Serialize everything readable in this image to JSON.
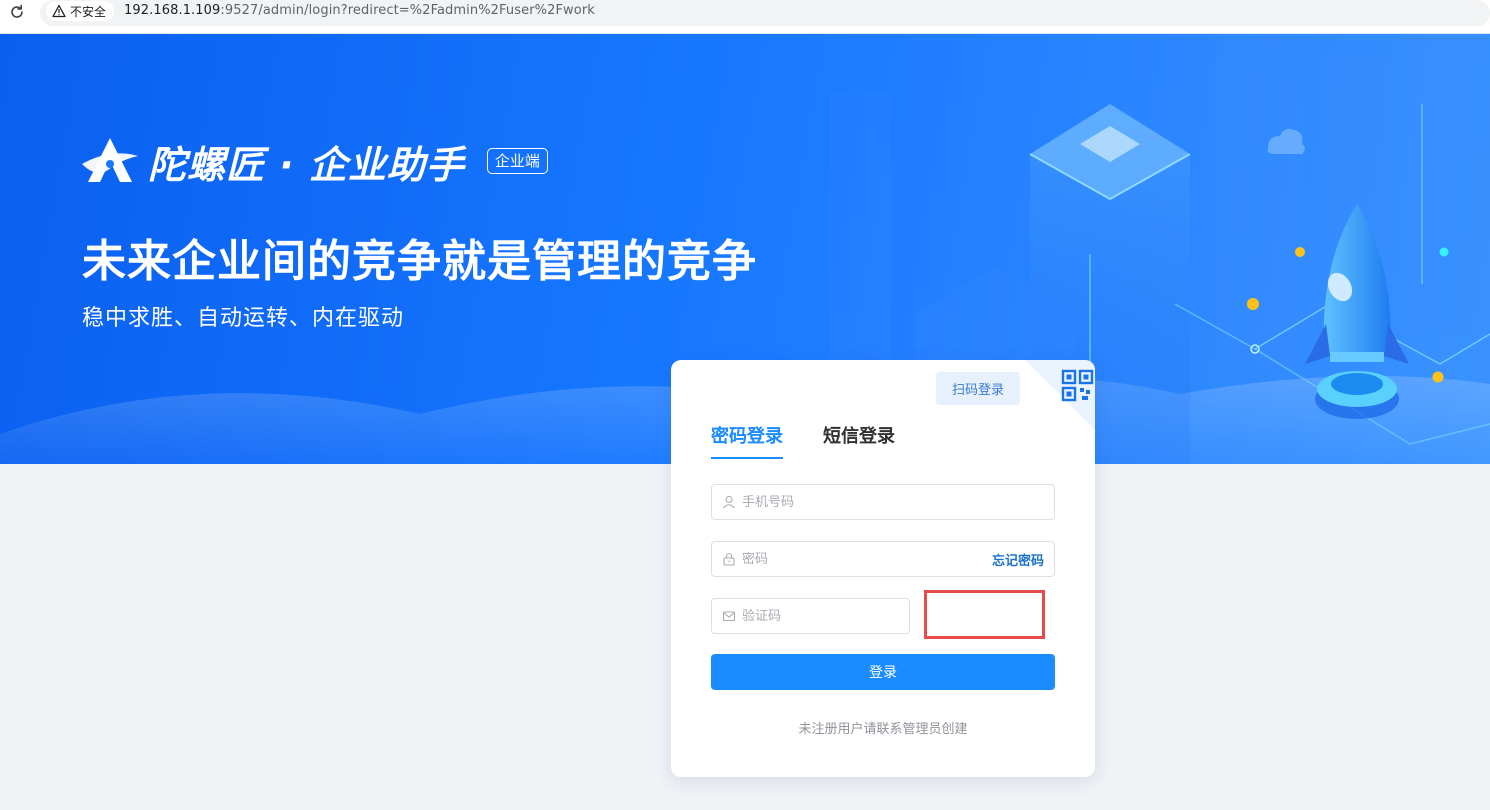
{
  "browser": {
    "security_label": "不安全",
    "url_host": "192.168.1.109",
    "url_rest": ":9527/admin/login?redirect=%2Fadmin%2Fuser%2Fwork",
    "icons": {
      "reload": "reload-icon",
      "warning": "warning-icon"
    }
  },
  "hero": {
    "brand_name": "陀螺匠 · 企业助手",
    "brand_badge": "企业端",
    "headline": "未来企业间的竞争就是管理的竞争",
    "subline": "稳中求胜、自动运转、内在驱动",
    "colors": {
      "primary": "#1677ff",
      "accent_dark": "#0a5ff0"
    }
  },
  "login": {
    "qr_login_label": "扫码登录",
    "tabs": [
      {
        "label": "密码登录",
        "active": true
      },
      {
        "label": "短信登录",
        "active": false
      }
    ],
    "phone": {
      "placeholder": "手机号码",
      "value": "",
      "icon": "user-icon"
    },
    "password": {
      "placeholder": "密码",
      "value": "",
      "icon": "lock-icon",
      "forgot_label": "忘记密码"
    },
    "captcha": {
      "placeholder": "验证码",
      "value": "",
      "icon": "mail-icon"
    },
    "submit_label": "登录",
    "register_tip": "未注册用户请联系管理员创建",
    "colors": {
      "button": "#1a8cff",
      "captcha_highlight": "#e64a4a"
    }
  }
}
